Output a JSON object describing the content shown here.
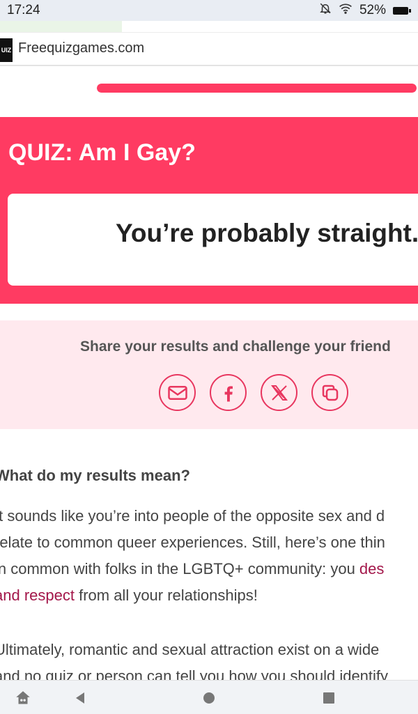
{
  "status_bar": {
    "time": "17:24",
    "battery_text": "52%",
    "icons": [
      "bell-off-icon",
      "wifi-icon",
      "battery-icon"
    ]
  },
  "browser": {
    "site_icon_text": "UIZ",
    "url": "Freequizgames.com"
  },
  "progress": {
    "fraction": 1.0
  },
  "quiz": {
    "title": "QUIZ: Am I Gay?",
    "result": "You’re probably straight."
  },
  "share": {
    "text": "Share your results and challenge your friend",
    "buttons": [
      "email-icon",
      "facebook-icon",
      "x-icon",
      "copy-icon"
    ]
  },
  "article": {
    "heading": "What do my results mean?",
    "p1": {
      "line1": "It sounds like you’re into people of the opposite sex and d",
      "line2": "relate to common queer experiences. Still, here’s one thin",
      "line3_a": "in common with folks in the LGBTQ+ community: you ",
      "line3_link": "des",
      "line4_link": "and respect",
      "line4_b": " from all your relationships!"
    },
    "p2": {
      "line1": "Ultimately, romantic and sexual attraction exist on a wide",
      "line2": "and no quiz or person can tell you how you should identify"
    }
  },
  "colors": {
    "accent": "#ff3b62",
    "share_bg": "#ffe9ee",
    "link": "#a3174a"
  },
  "nav": [
    "home-icon",
    "back-icon",
    "circle-home-icon",
    "recents-icon"
  ]
}
